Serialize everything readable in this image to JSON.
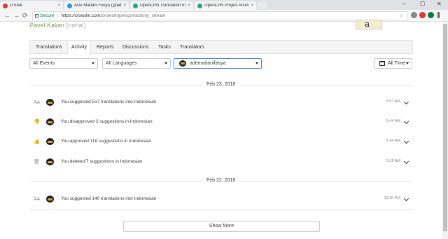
{
  "browser": {
    "tabs": [
      {
        "label": "DTube",
        "color": "#e53935"
      },
      {
        "label": "ADe Madani Fasya (@ad...",
        "color": "#1da1f2"
      },
      {
        "label": "OpenCPN Translation Inc",
        "color": "#26a69a"
      },
      {
        "label": "OpenCPN Project Activit",
        "color": "#26a69a"
      }
    ],
    "close_glyph": "×",
    "window_controls": [
      "–",
      "☐",
      "✕"
    ],
    "back": "←",
    "forward": "→",
    "reload": "⟳",
    "secure_label": "Secure",
    "url_sep": "|",
    "url_host": "https://crowdin.com",
    "url_path": "/project/opencpn/activity_stream",
    "star": "☆"
  },
  "profile": {
    "name": "Pavel Kalian",
    "handle": "(nohal)",
    "avatar_text": "a"
  },
  "nav": {
    "tabs": [
      "Translations",
      "Activity",
      "Reports",
      "Discussions",
      "Tasks",
      "Translators"
    ],
    "active": "Activity"
  },
  "filters": {
    "events": "All Events",
    "languages": "All Languages",
    "user": "ademadanifasya",
    "time": "All Time"
  },
  "groups": [
    {
      "date": "Feb 23, 2018",
      "items": [
        {
          "icon": "translate-icon",
          "glyph": "A̶A",
          "text": "You suggested 517 translations into Indonesian",
          "time": "5:57 AM"
        },
        {
          "icon": "thumbs-down-icon",
          "glyph": "👎",
          "text": "You disapproved 2 suggestions in Indonesian",
          "time": "5:44 AM"
        },
        {
          "icon": "thumbs-up-icon",
          "glyph": "👍",
          "text": "You approved 118 suggestions in Indonesian",
          "time": "5:44 AM"
        },
        {
          "icon": "trash-icon",
          "glyph": "🗑",
          "text": "You deleted 7 suggestions in Indonesian",
          "time": "5:15 AM"
        }
      ]
    },
    {
      "date": "Feb 22, 2018",
      "items": [
        {
          "icon": "translate-icon",
          "glyph": "A̶A",
          "text": "You suggested 140 translations into Indonesian",
          "time": "10:36 PM"
        }
      ]
    }
  ],
  "show_more": "Show More"
}
